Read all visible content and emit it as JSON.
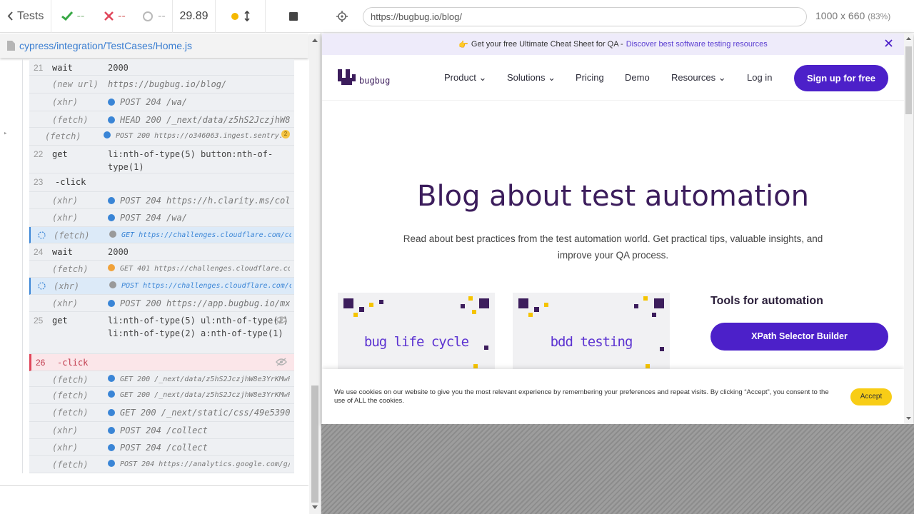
{
  "reporter": {
    "tests_label": "Tests",
    "passed": "--",
    "failed": "--",
    "pending": "--",
    "duration": "29.89",
    "spec_path": "cypress/integration/TestCases/Home.js"
  },
  "commands": [
    {
      "num": "21",
      "name": "wait",
      "message": "2000",
      "kind": "cmd"
    },
    {
      "num": "",
      "name": "(new url)",
      "message": "https://bugbug.io/blog/",
      "kind": "url"
    },
    {
      "num": "",
      "name": "(xhr)",
      "message": "POST 204 /wa/",
      "kind": "req",
      "dot": "blue"
    },
    {
      "num": "",
      "name": "(fetch)",
      "message": "HEAD 200 /_next/data/z5hS2JczjhW8e…",
      "kind": "req",
      "dot": "blue"
    },
    {
      "num": "",
      "name": "(fetch)",
      "message": "POST 200 https://o346063.ingest.sentry.i…",
      "kind": "req-sm",
      "dot": "blue",
      "badge": "2"
    },
    {
      "num": "22",
      "name": "get",
      "message": "li:nth-of-type(5) button:nth-of-type(1)",
      "kind": "cmd2"
    },
    {
      "num": "23",
      "name": "-click",
      "message": "",
      "kind": "cmd"
    },
    {
      "num": "",
      "name": "(xhr)",
      "message": "POST 204 https://h.clarity.ms/coll…",
      "kind": "req",
      "dot": "blue"
    },
    {
      "num": "",
      "name": "(xhr)",
      "message": "POST 204 /wa/",
      "kind": "req",
      "dot": "blue"
    },
    {
      "num": "",
      "name": "(fetch)",
      "message": "GET https://challenges.cloudflare.com/cdn…",
      "kind": "pending",
      "dot": "gray"
    },
    {
      "num": "24",
      "name": "wait",
      "message": "2000",
      "kind": "cmd"
    },
    {
      "num": "",
      "name": "(fetch)",
      "message": "GET 401 https://challenges.cloudflare.com…",
      "kind": "req-sm",
      "dot": "orange"
    },
    {
      "num": "",
      "name": "(xhr)",
      "message": "POST https://challenges.cloudflare.com/cd…",
      "kind": "pending",
      "dot": "gray"
    },
    {
      "num": "",
      "name": "(xhr)",
      "message": "POST 200 https://app.bugbug.io/mx/…",
      "kind": "req",
      "dot": "blue"
    },
    {
      "num": "25",
      "name": "get",
      "message": "li:nth-of-type(5) ul:nth-of-type(1) li:nth-of-type(2) a:nth-of-type(1)",
      "kind": "cmd3"
    },
    {
      "num": "26",
      "name": "-click",
      "message": "",
      "kind": "err"
    },
    {
      "num": "",
      "name": "(fetch)",
      "message": "GET 200 /_next/data/z5hS2JczjhW8e3YrKMwFz…",
      "kind": "req-sm",
      "dot": "blue"
    },
    {
      "num": "",
      "name": "(fetch)",
      "message": "GET 200 /_next/data/z5hS2JczjhW8e3YrKMwFz…",
      "kind": "req-sm",
      "dot": "blue"
    },
    {
      "num": "",
      "name": "(fetch)",
      "message": "GET 200 /_next/static/css/49e53905…",
      "kind": "req",
      "dot": "blue"
    },
    {
      "num": "",
      "name": "(xhr)",
      "message": "POST 204 /collect",
      "kind": "req",
      "dot": "blue"
    },
    {
      "num": "",
      "name": "(xhr)",
      "message": "POST 204 /collect",
      "kind": "req",
      "dot": "blue"
    },
    {
      "num": "",
      "name": "(fetch)",
      "message": "POST 204 https://analytics.google.com/g/c…",
      "kind": "req-sm",
      "dot": "blue"
    }
  ],
  "aut": {
    "url": "https://bugbug.io/blog/",
    "viewport_size": "1000 x 660",
    "scale": "(83%)"
  },
  "site": {
    "banner_text": "Get your free Ultimate Cheat Sheet for QA -",
    "banner_link": "Discover best software testing resources",
    "brand": "bugbug",
    "nav": [
      "Product",
      "Solutions",
      "Pricing",
      "Demo",
      "Resources"
    ],
    "login": "Log in",
    "signup": "Sign up for free",
    "hero_title": "Blog about test automation",
    "hero_subtitle": "Read about best practices from the test automation world. Get practical tips, valuable insights, and improve your QA process.",
    "cards": [
      "bug life cycle",
      "bdd testing"
    ],
    "tools_title": "Tools for automation",
    "tools_button": "XPath Selector Builder",
    "cookie_text": "We use cookies on our website to give you the most relevant experience by remembering your preferences and repeat visits. By clicking “Accept”, you consent to the use of ALL the cookies.",
    "accept": "Accept"
  },
  "colors": {
    "accent": "#4c20c9",
    "heading": "#3c1d5c",
    "error": "#e0455a",
    "accept": "#f8cd16"
  }
}
